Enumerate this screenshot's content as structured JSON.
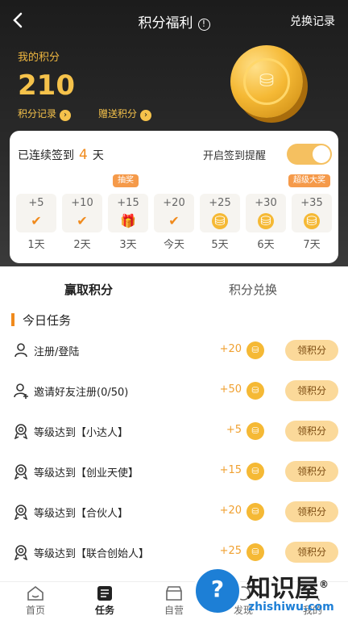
{
  "header": {
    "title": "积分福利",
    "right_link": "兑换记录"
  },
  "points": {
    "label": "我的积分",
    "value": "210",
    "record_link": "积分记录",
    "gift_link": "赠送积分"
  },
  "signin": {
    "streak_prefix": "已连续签到",
    "streak_days": "4",
    "streak_suffix": "天",
    "remind_label": "开启签到提醒",
    "remind_on": true,
    "days": [
      {
        "points": "+5",
        "label": "1天",
        "state": "checked"
      },
      {
        "points": "+10",
        "label": "2天",
        "state": "checked"
      },
      {
        "points": "+15",
        "label": "3天",
        "state": "gift",
        "badge": "抽奖"
      },
      {
        "points": "+20",
        "label": "今天",
        "state": "checked"
      },
      {
        "points": "+25",
        "label": "5天",
        "state": "coin"
      },
      {
        "points": "+30",
        "label": "6天",
        "state": "coin"
      },
      {
        "points": "+35",
        "label": "7天",
        "state": "coin",
        "badge": "超级大奖"
      }
    ]
  },
  "tabs": {
    "earn": "赢取积分",
    "exchange": "积分兑换"
  },
  "today": {
    "title": "今日任务",
    "tasks": [
      {
        "label": "注册/登陆",
        "points": "+20",
        "button": "领积分",
        "icon": "user-icon"
      },
      {
        "label": "邀请好友注册(0/50)",
        "points": "+50",
        "button": "领积分",
        "icon": "user-add-icon"
      },
      {
        "label": "等级达到【小达人】",
        "points": "+5",
        "button": "领积分",
        "icon": "medal-icon"
      },
      {
        "label": "等级达到【创业天使】",
        "points": "+15",
        "button": "领积分",
        "icon": "medal-icon"
      },
      {
        "label": "等级达到【合伙人】",
        "points": "+20",
        "button": "领积分",
        "icon": "medal-icon"
      },
      {
        "label": "等级达到【联合创始人】",
        "points": "+25",
        "button": "领积分",
        "icon": "medal-icon"
      }
    ]
  },
  "tabbar": {
    "home": "首页",
    "tasks": "任务",
    "store": "自营",
    "publish": "发现",
    "mine": "我的"
  },
  "watermark": {
    "cn": "知识屋",
    "en": "zhishiwu.com",
    "reg": "®"
  },
  "colors": {
    "accent": "#f08a1c",
    "gold": "#f5c24b",
    "button": "#fbd99a"
  }
}
